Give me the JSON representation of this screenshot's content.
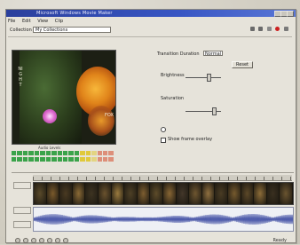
{
  "window": {
    "title": "Microsoft Windows Movie Maker"
  },
  "menu": {
    "items": [
      "File",
      "Edit",
      "View",
      "Clip"
    ]
  },
  "toolbar": {
    "label": "Collection",
    "combo_value": "My Collections"
  },
  "preview": {
    "vertical_text": "NIGHT",
    "vertical_text_right": "FOX"
  },
  "meters": {
    "label": "Audio Levels"
  },
  "panel": {
    "effect_label": "Transition Duration",
    "effect_value": "Normal",
    "button_label": "Reset",
    "brightness_label": "Brightness",
    "saturation_label": "Saturation",
    "checkbox_label": "Show frame overlay"
  },
  "status": {
    "text": "Ready"
  },
  "colors": {
    "titlebar": "#2a3f9c",
    "meter_green": "#3aa34a",
    "meter_yellow": "#e0c93a",
    "meter_red": "#d64a2a",
    "waveform": "#2a3a9a"
  }
}
